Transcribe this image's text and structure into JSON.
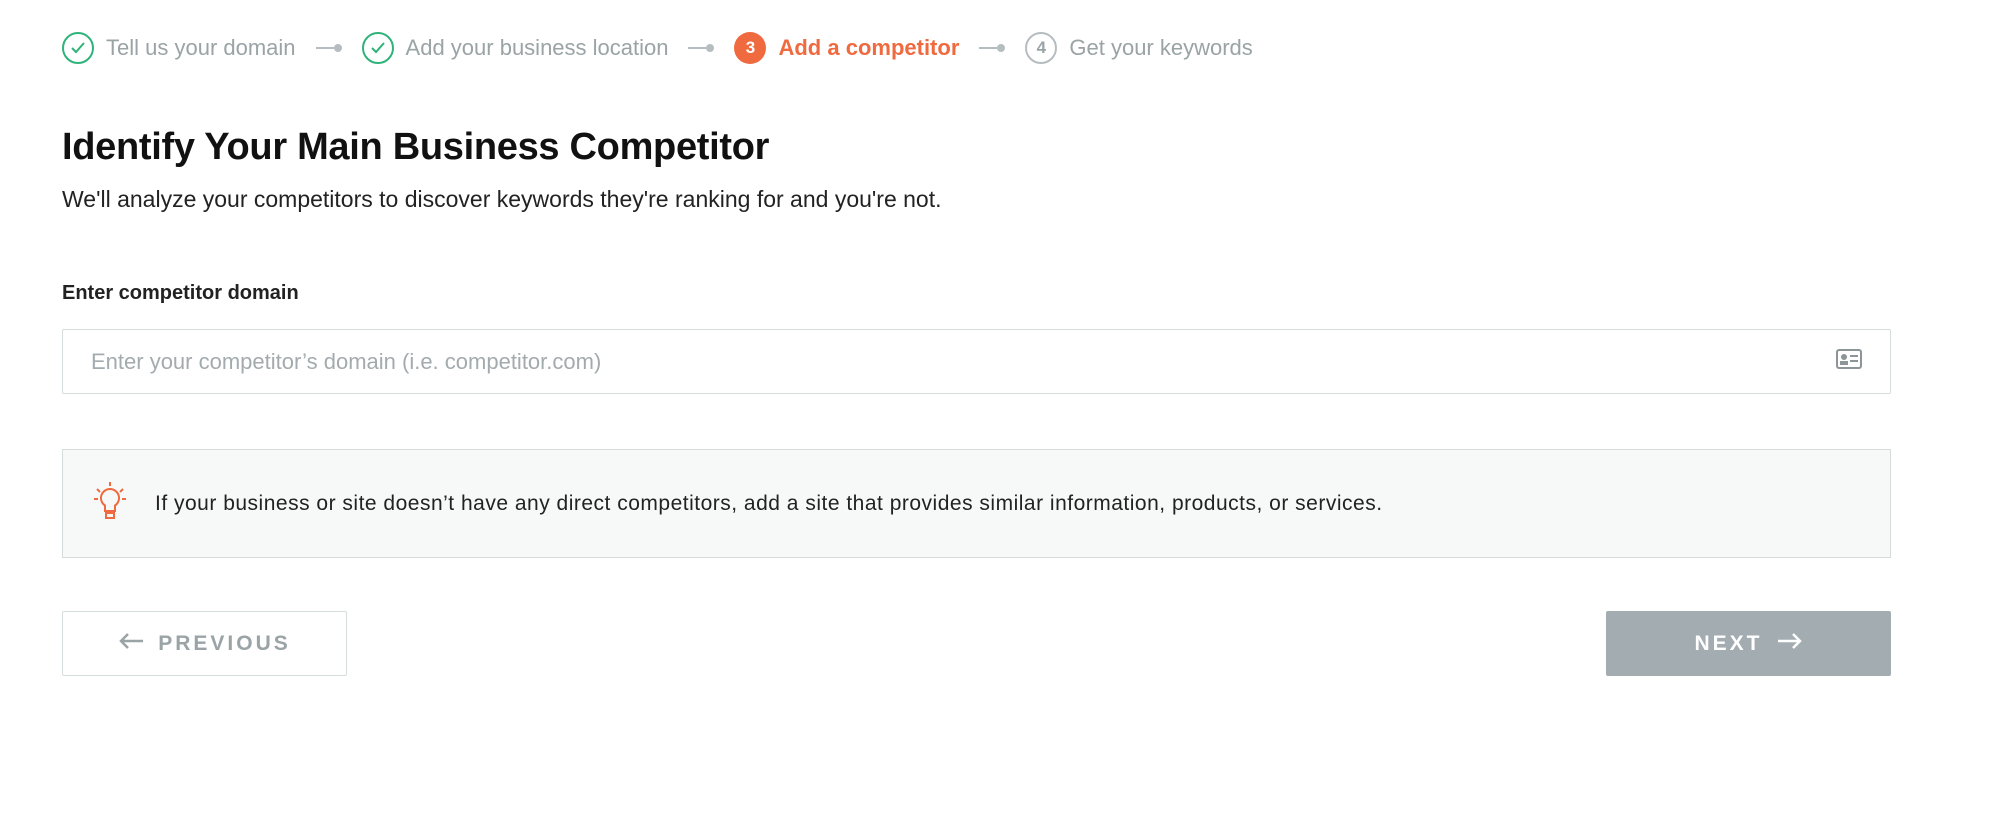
{
  "stepper": {
    "steps": [
      {
        "label": "Tell us your domain",
        "state": "done",
        "marker": "check-icon"
      },
      {
        "label": "Add your business location",
        "state": "done",
        "marker": "check-icon"
      },
      {
        "label": "Add a competitor",
        "state": "active",
        "number": "3"
      },
      {
        "label": "Get your keywords",
        "state": "todo",
        "number": "4"
      }
    ]
  },
  "page": {
    "title": "Identify Your Main Business Competitor",
    "subtitle": "We'll analyze your competitors to discover keywords they're ranking for and you're not."
  },
  "form": {
    "label": "Enter competitor domain",
    "value": "",
    "placeholder": "Enter your competitor’s domain (i.e. competitor.com)",
    "icon": "contact-card-icon"
  },
  "tip": {
    "icon": "lightbulb-icon",
    "text": "If your business or site doesn’t have any direct competitors, add a site that provides similar information, products, or services."
  },
  "buttons": {
    "previous": "PREVIOUS",
    "next": "NEXT"
  },
  "colors": {
    "accent": "#f06a3f",
    "done": "#2fb37a",
    "disabled_button": "#a3adb1"
  }
}
